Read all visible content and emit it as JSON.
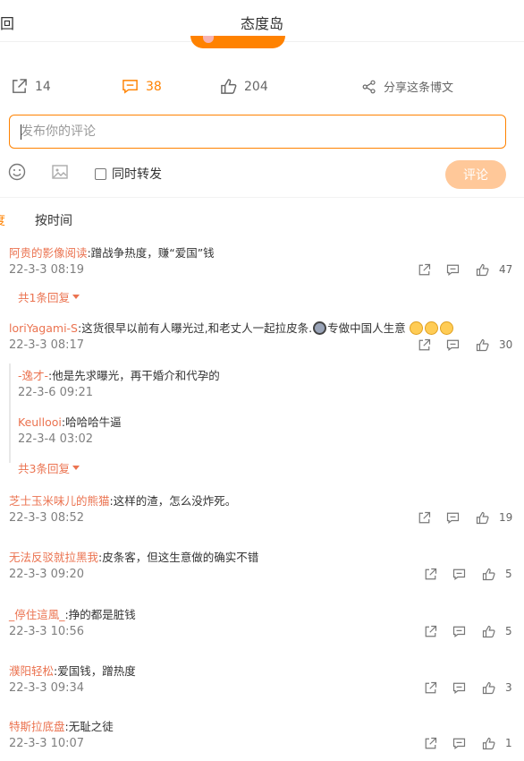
{
  "header": {
    "back_label": "回",
    "title": "态度岛"
  },
  "actions": {
    "repost_count": "14",
    "comment_count": "38",
    "like_count": "204",
    "share_label": "分享这条博文"
  },
  "composer": {
    "placeholder": "发布你的评论",
    "repost_label": "同时转发",
    "submit_label": "评论"
  },
  "sort": {
    "hot_label": "度",
    "time_label": "按时间"
  },
  "comments": [
    {
      "user": "阿贵的影像阅读",
      "text": ":蹭战争热度，赚“爱国”钱",
      "time": "22-3-3 08:19",
      "likes": "47",
      "more": "共1条回复"
    },
    {
      "user": "loriYagami-S",
      "text_a": ":这货很早以前有人曝光过,和老丈人一起拉皮条.",
      "text_b": "专做中国人生意",
      "time": "22-3-3 08:17",
      "likes": "30",
      "more": "共3条回复",
      "replies": [
        {
          "user": "-逸才-",
          "text": ":他是先求曝光，再干婚介和代孕的",
          "time": "22-3-6 09:21"
        },
        {
          "user": "Keullooi",
          "text": ":哈哈哈牛逼",
          "time": "22-3-4 03:02"
        }
      ]
    },
    {
      "user": "芝士玉米味儿的熊猫",
      "text": ":这样的渣，怎么没炸死。",
      "time": "22-3-3 08:52",
      "likes": "19"
    },
    {
      "user": "无法反驳就拉黑我",
      "text": ":皮条客，但这生意做的确实不错",
      "time": "22-3-3 09:20",
      "likes": "5"
    },
    {
      "user": "_停住這風_",
      "text": ":挣的都是脏钱",
      "time": "22-3-3 10:56",
      "likes": "5"
    },
    {
      "user": "濮阳轻松",
      "text": ":爱国钱，蹭热度",
      "time": "22-3-3 09:34",
      "likes": "3"
    },
    {
      "user": "特斯拉底盘",
      "text": ":无耻之徒",
      "time": "22-3-3 10:07",
      "likes": "1"
    }
  ],
  "colors": {
    "accent": "#ff8200",
    "username": "#eb7350",
    "submit_disabled": "#ffc899"
  }
}
